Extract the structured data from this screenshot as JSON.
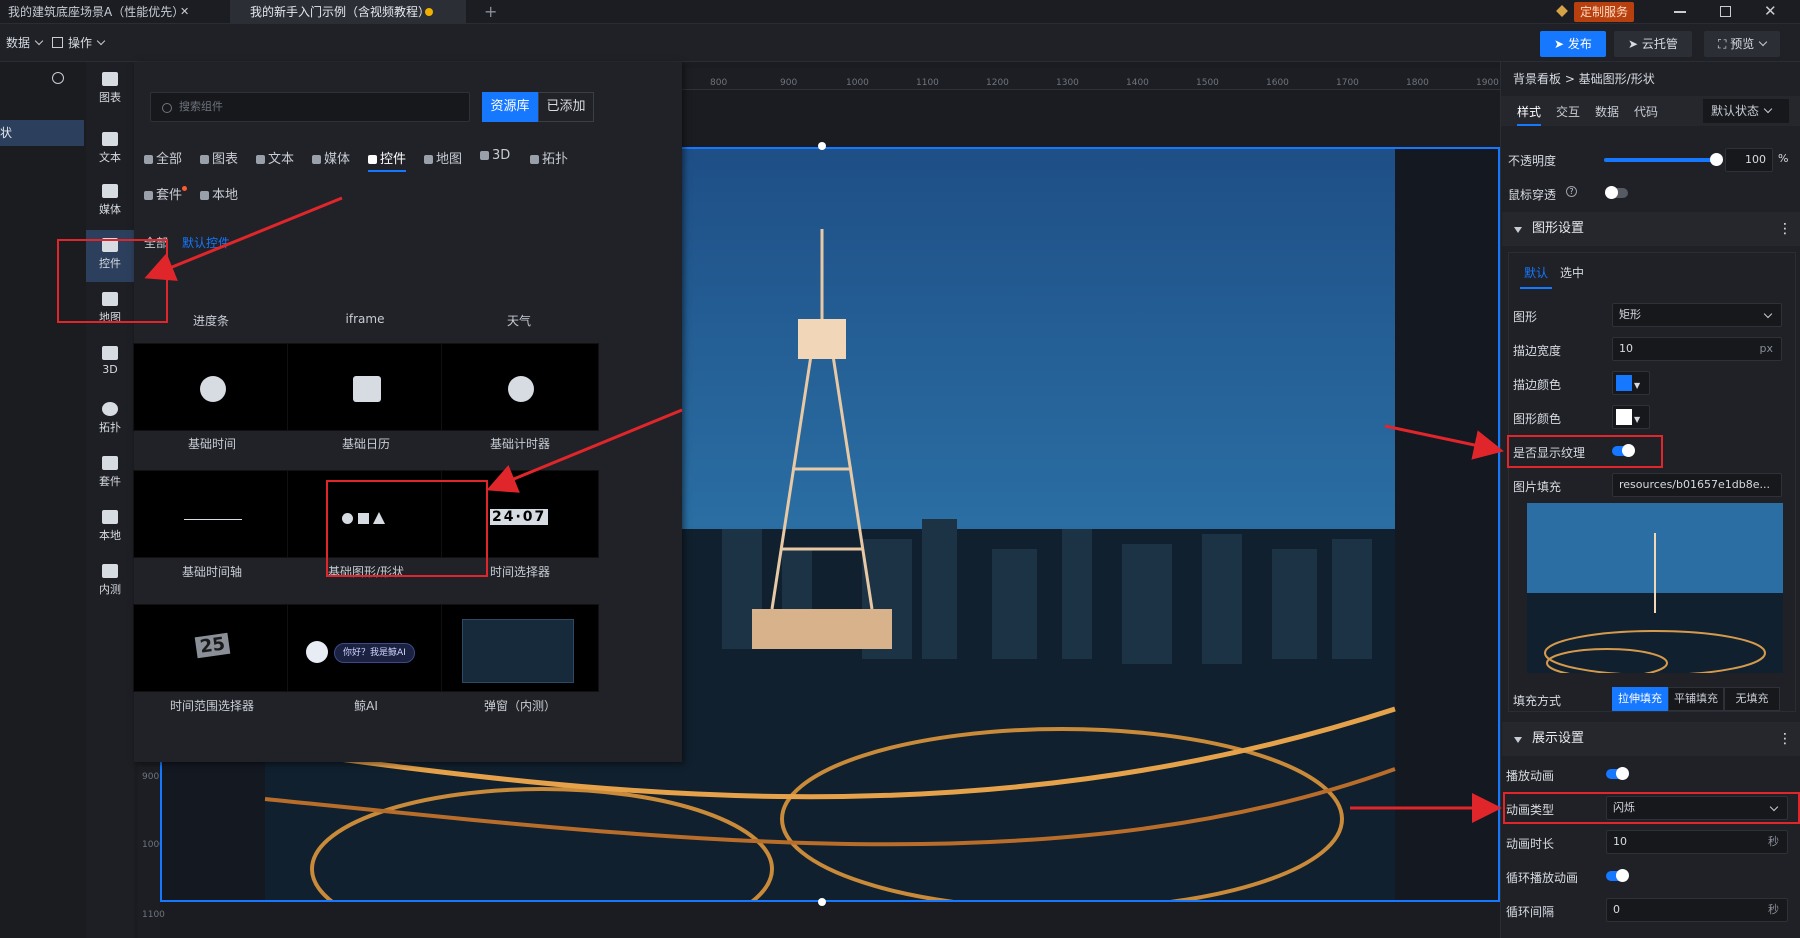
{
  "tabs": [
    {
      "label": "我的建筑底座场景A（性能优先）"
    },
    {
      "label": "我的新手入门示例（含视频教程）"
    }
  ],
  "tab_close": "✕",
  "tab_add": "+",
  "custom_service": "定制服务",
  "toolbar": {
    "data_menu": "数据",
    "ops_menu": "操作",
    "publish": "发布",
    "cloud_host": "云托管",
    "preview": "预览"
  },
  "left_menu": {
    "item": "状"
  },
  "rail": [
    {
      "label": "图表"
    },
    {
      "label": "文本"
    },
    {
      "label": "媒体"
    },
    {
      "label": "控件"
    },
    {
      "label": "地图"
    },
    {
      "label": "3D"
    },
    {
      "label": "拓扑"
    },
    {
      "label": "套件"
    },
    {
      "label": "本地"
    },
    {
      "label": "内测"
    }
  ],
  "component_panel": {
    "search_placeholder": "搜索组件",
    "tab_library": "资源库",
    "tab_added": "已添加",
    "categories": [
      {
        "label": "全部"
      },
      {
        "label": "图表"
      },
      {
        "label": "文本"
      },
      {
        "label": "媒体"
      },
      {
        "label": "控件"
      },
      {
        "label": "地图"
      },
      {
        "label": "3D"
      },
      {
        "label": "拓扑"
      },
      {
        "label": "套件"
      },
      {
        "label": "本地"
      }
    ],
    "sub_all": "全部",
    "sub_default": "默认控件",
    "top_row": [
      "进度条",
      "iframe",
      "天气"
    ],
    "items": [
      {
        "label": "基础时间"
      },
      {
        "label": "基础日历"
      },
      {
        "label": "基础计时器"
      },
      {
        "label": "基础时间轴"
      },
      {
        "label": "基础图形/形状"
      },
      {
        "label": "时间选择器"
      },
      {
        "label": "时间范围选择器"
      },
      {
        "label": "鲸AI"
      },
      {
        "label": "弹窗（内测）"
      }
    ],
    "ai_bubble": "你好？我是鲸AI",
    "time_digits": "24·07",
    "range_digits": "25"
  },
  "ruler": [
    "800",
    "900",
    "1000",
    "1100",
    "1200",
    "1300",
    "1400",
    "1500",
    "1600",
    "1700",
    "1800",
    "1900"
  ],
  "vruler": [
    "900",
    "1000",
    "1100"
  ],
  "right_panel": {
    "breadcrumb": "背景看板 > 基础图形/形状",
    "tabs": [
      "样式",
      "交互",
      "数据",
      "代码"
    ],
    "state_select": "默认状态",
    "opacity_label": "不透明度",
    "opacity_value": "100",
    "opacity_unit": "%",
    "opacity_level": 1.0,
    "mouse_through_label": "鼠标穿透",
    "shape_section": "图形设置",
    "sub_tabs": [
      "默认",
      "选中"
    ],
    "shape_label": "图形",
    "shape_value": "矩形",
    "stroke_width_label": "描边宽度",
    "stroke_width_value": "10",
    "stroke_width_unit": "px",
    "stroke_color_label": "描边颜色",
    "stroke_color": "#1677ff",
    "fill_color_label": "图形颜色",
    "fill_color": "#ffffff",
    "texture_label": "是否显示纹理",
    "image_fill_label": "图片填充",
    "image_fill_value": "resources/b01657e1db8e...",
    "fill_mode_label": "填充方式",
    "fill_modes": [
      "拉伸填充",
      "平铺填充",
      "无填充"
    ],
    "display_section": "展示设置",
    "play_anim_label": "播放动画",
    "anim_type_label": "动画类型",
    "anim_type_value": "闪烁",
    "anim_duration_label": "动画时长",
    "anim_duration_value": "10",
    "anim_duration_unit": "秒",
    "loop_label": "循环播放动画",
    "loop_interval_label": "循环间隔",
    "loop_interval_value": "0",
    "loop_interval_unit": "秒"
  },
  "colors": {
    "accent": "#1677ff",
    "annotation": "#e0262b",
    "custom_service": "#b8400e"
  }
}
